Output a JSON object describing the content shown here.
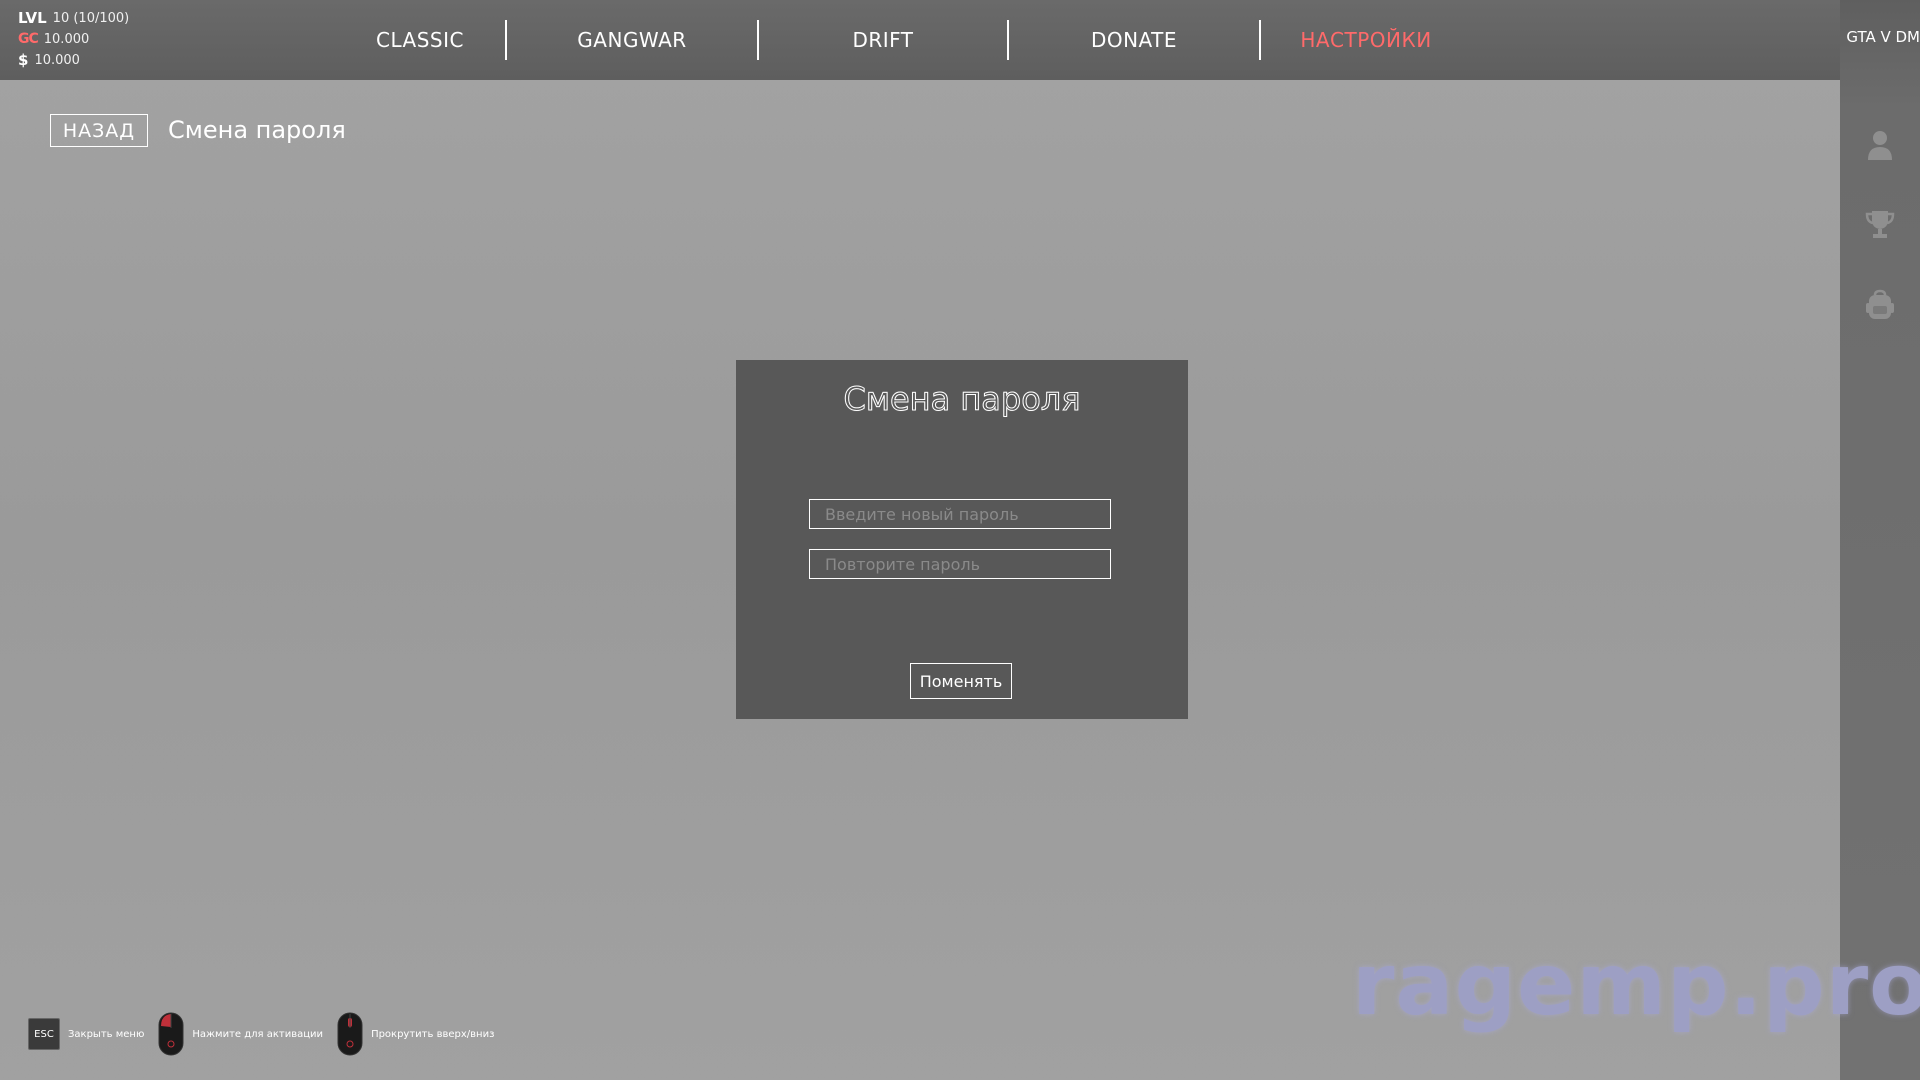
{
  "stats": {
    "lvl_label": "LVL",
    "lvl_value": "10 (10/100)",
    "gc_label": "GC",
    "gc_value": "10.000",
    "money_label": "$",
    "money_value": "10.000"
  },
  "nav": {
    "items": [
      {
        "label": "CLASSIC"
      },
      {
        "label": "GANGWAR"
      },
      {
        "label": "DRIFT"
      },
      {
        "label": "DONATE"
      },
      {
        "label": "НАСТРОЙКИ"
      }
    ],
    "active_index": 4
  },
  "brand": "GTA V DM",
  "sidebar": {
    "icons": [
      "user-icon",
      "trophy-icon",
      "backpack-icon"
    ]
  },
  "subheader": {
    "back_label": "НАЗАД",
    "title": "Смена пароля"
  },
  "modal": {
    "title": "Смена пароля",
    "new_password_placeholder": "Введите новый пароль",
    "repeat_password_placeholder": "Повторите пароль",
    "submit_label": "Поменять"
  },
  "hints": {
    "esc_key": "ESC",
    "close_menu": "Закрыть меню",
    "click_activate": "Нажмите для активации",
    "scroll": "Прокрутить вверх/вниз"
  },
  "watermark": "ragemp.pro",
  "colors": {
    "accent": "#ff6a6a",
    "topbar": "#636363",
    "modal_bg": "#585858",
    "page_bg": "#9e9e9e"
  }
}
